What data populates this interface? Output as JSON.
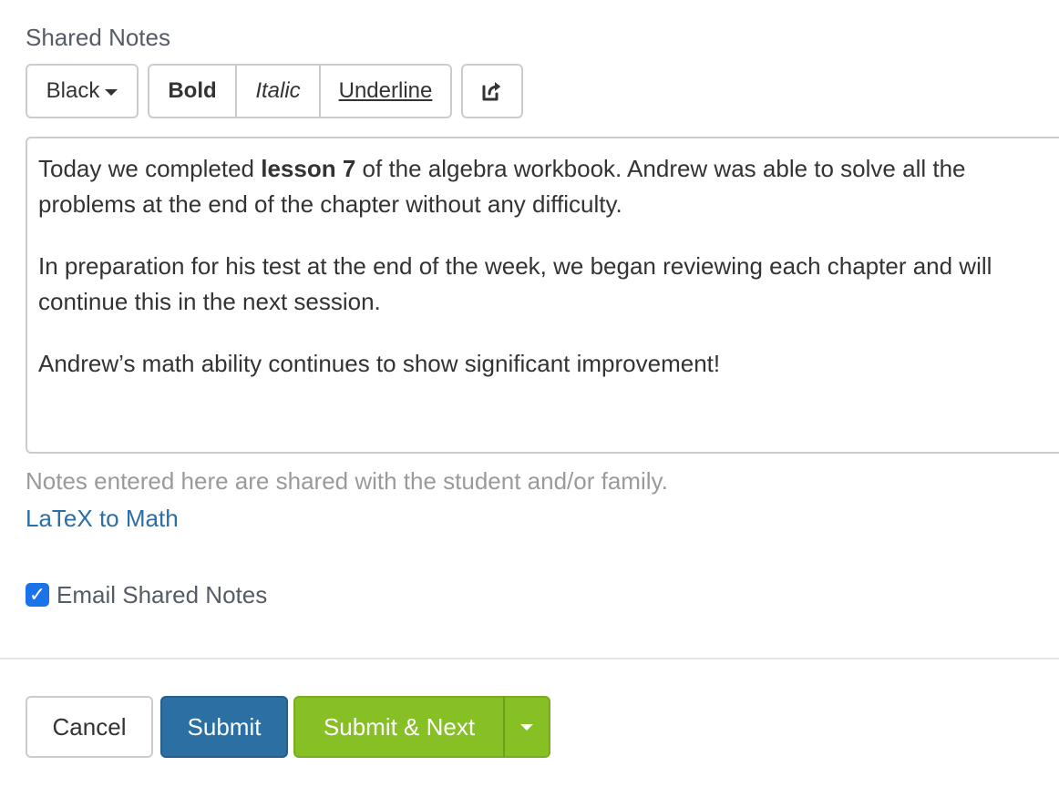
{
  "section": {
    "label": "Shared Notes"
  },
  "toolbar": {
    "color_label": "Black",
    "bold_label": "Bold",
    "italic_label": "Italic",
    "underline_label": "Underline",
    "share_icon": "share-icon"
  },
  "editor": {
    "p1_before": "Today we completed ",
    "p1_bold": "lesson 7",
    "p1_after_line1": " of the algebra workbook. Andrew was able to solve all the",
    "p1_line2": "problems at the end of the chapter without any difficulty.",
    "p2_line1": "In preparation for his test at the end of the week, we began reviewing each chapter and will",
    "p2_line2": "continue this in the next session.",
    "p3": "Andrew’s math ability continues to show significant improvement!"
  },
  "help_text": "Notes entered here are shared with the student and/or family.",
  "latex_link": "LaTeX to Math",
  "email_checkbox": {
    "label": "Email Shared Notes",
    "checked": true
  },
  "footer": {
    "cancel_label": "Cancel",
    "submit_label": "Submit",
    "submit_next_label": "Submit & Next"
  },
  "colors": {
    "submit": "#2b6fa3",
    "submit_next": "#86c024",
    "link": "#2a6fa8",
    "checkbox": "#1a73e8"
  }
}
